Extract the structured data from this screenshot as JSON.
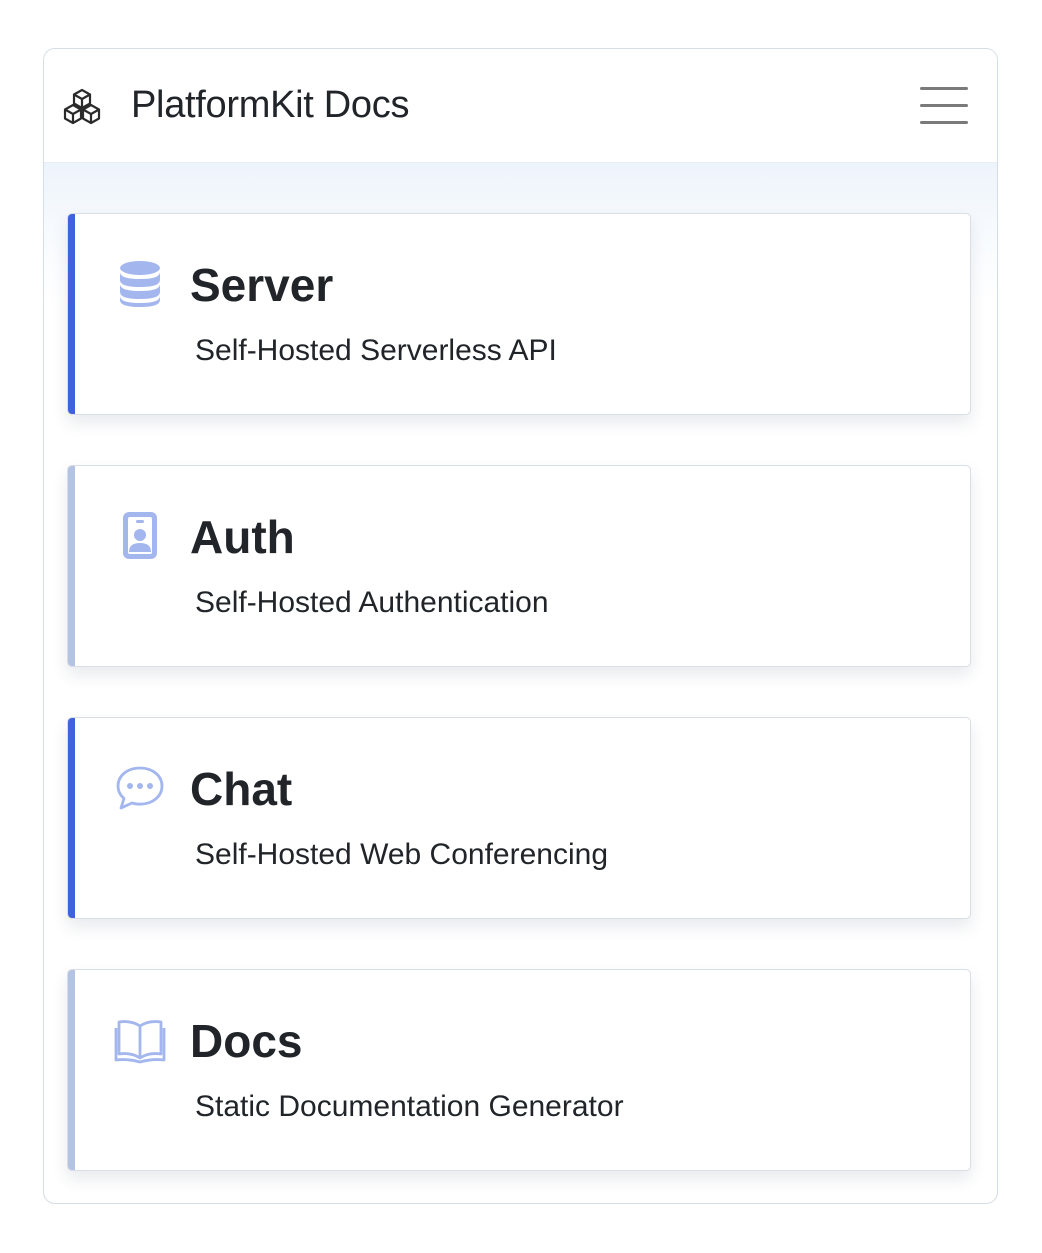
{
  "navbar": {
    "brand": "PlatformKit Docs",
    "logo_icon": "cubes-icon",
    "menu_icon": "hamburger-menu-icon"
  },
  "cards": [
    {
      "title": "Server",
      "description": "Self-Hosted Serverless API",
      "icon": "database-icon",
      "accent": "#3f63e0",
      "active": true
    },
    {
      "title": "Auth",
      "description": "Self-Hosted Authentication",
      "icon": "id-badge-icon",
      "accent": "#b4c3e3",
      "active": false
    },
    {
      "title": "Chat",
      "description": "Self-Hosted Web Conferencing",
      "icon": "chat-bubble-icon",
      "accent": "#3f63e0",
      "active": true
    },
    {
      "title": "Docs",
      "description": "Static Documentation Generator",
      "icon": "book-icon",
      "accent": "#b4c3e3",
      "active": false
    }
  ],
  "colors": {
    "icon": "#a3b6ee",
    "text": "#212529",
    "border": "#d9dee4"
  }
}
